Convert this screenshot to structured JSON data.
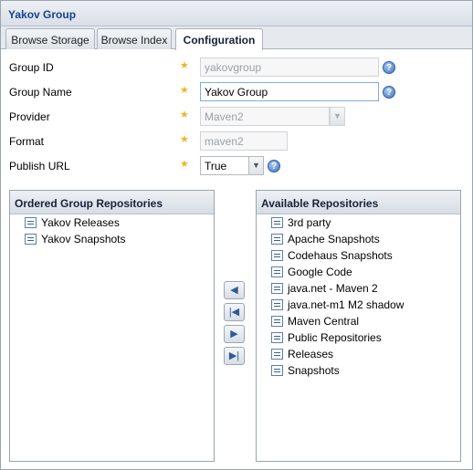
{
  "window": {
    "title": "Yakov Group"
  },
  "tabs": [
    {
      "label": "Browse Storage"
    },
    {
      "label": "Browse Index"
    },
    {
      "label": "Configuration",
      "active": true
    }
  ],
  "form": {
    "group_id": {
      "label": "Group ID",
      "value": "yakovgroup",
      "disabled": true
    },
    "group_name": {
      "label": "Group Name",
      "value": "Yakov Group"
    },
    "provider": {
      "label": "Provider",
      "value": "Maven2",
      "disabled": true
    },
    "format": {
      "label": "Format",
      "value": "maven2",
      "disabled": true
    },
    "publish_url": {
      "label": "Publish URL",
      "value": "True"
    }
  },
  "ordered": {
    "header": "Ordered Group Repositories",
    "items": [
      "Yakov Releases",
      "Yakov Snapshots"
    ]
  },
  "available": {
    "header": "Available Repositories",
    "items": [
      "3rd party",
      "Apache Snapshots",
      "Codehaus Snapshots",
      "Google Code",
      "java.net - Maven 2",
      "java.net-m1 M2 shadow",
      "Maven Central",
      "Public Repositories",
      "Releases",
      "Snapshots"
    ]
  },
  "movers": {
    "add_icon": "arrow-left-icon",
    "add_all_icon": "arrow-left-end-icon",
    "remove_icon": "arrow-right-icon",
    "remove_all_icon": "arrow-right-end-icon"
  },
  "colors": {
    "accent": "#15428b",
    "required_star": "#e8b923",
    "help": "#3f74c2"
  }
}
